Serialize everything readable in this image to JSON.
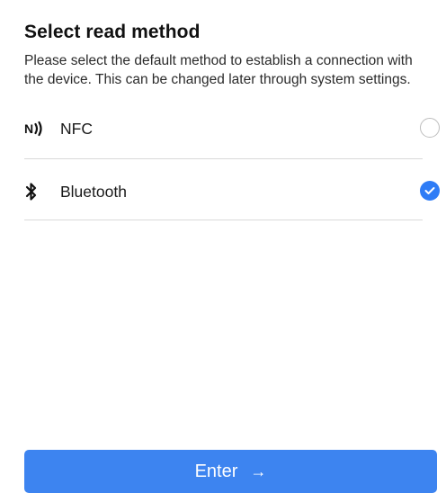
{
  "header": {
    "title": "Select read method",
    "description": "Please select the default method to establish a connection with the device. This can be changed later through system settings."
  },
  "options": [
    {
      "label": "NFC",
      "icon": "nfc-icon",
      "selected": false
    },
    {
      "label": "Bluetooth",
      "icon": "bluetooth-icon",
      "selected": true
    }
  ],
  "footer": {
    "enter_label": "Enter",
    "enter_arrow": "→"
  },
  "colors": {
    "accent": "#3d84f0",
    "check": "#2e7cf6"
  }
}
